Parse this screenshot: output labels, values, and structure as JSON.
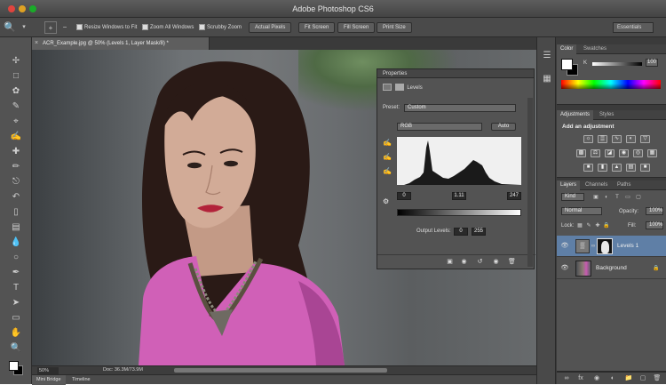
{
  "app": {
    "title": "Adobe Photoshop CS6"
  },
  "options_bar": {
    "checks": [
      "Resize Windows to Fit",
      "Zoom All Windows",
      "Scrubby Zoom"
    ],
    "buttons": [
      "Actual Pixels",
      "Fit Screen",
      "Fill Screen",
      "Print Size"
    ],
    "workspace": "Essentials"
  },
  "document": {
    "tab": "ACR_Example.jpg @ 50% (Levels 1, Layer Mask/8) *",
    "zoom": "50%",
    "info": "Doc: 36.3M/73.9M"
  },
  "mini_bridge": {
    "tabs": [
      "Mini Bridge",
      "Timeline"
    ]
  },
  "properties": {
    "title": "Properties",
    "panel_name": "Levels",
    "preset_label": "Preset:",
    "preset_value": "Custom",
    "channel": "RGB",
    "auto_label": "Auto",
    "input_values": [
      "0",
      "1.11",
      "247"
    ],
    "output_label": "Output Levels:",
    "output_values": [
      "0",
      "255"
    ]
  },
  "color_panel": {
    "tabs": [
      "Color",
      "Swatches"
    ],
    "k_label": "K",
    "k_value": "100"
  },
  "adjustments_panel": {
    "tabs": [
      "Adjustments",
      "Styles"
    ],
    "title": "Add an adjustment"
  },
  "layers_panel": {
    "tabs": [
      "Layers",
      "Channels",
      "Paths"
    ],
    "kind": "Kind",
    "blend_mode": "Normal",
    "opacity_label": "Opacity:",
    "opacity_value": "100%",
    "lock_label": "Lock:",
    "fill_label": "Fill:",
    "fill_value": "100%",
    "layers": [
      {
        "name": "Levels 1",
        "selected": true
      },
      {
        "name": "Background",
        "selected": false
      }
    ]
  },
  "icons": {
    "tools": [
      "move-icon",
      "marquee-icon",
      "lasso-icon",
      "quick-select-icon",
      "crop-icon",
      "eyedropper-icon",
      "healing-icon",
      "brush-icon",
      "stamp-icon",
      "history-brush-icon",
      "eraser-icon",
      "gradient-icon",
      "blur-icon",
      "dodge-icon",
      "pen-icon",
      "type-icon",
      "path-select-icon",
      "shape-icon",
      "hand-icon",
      "zoom-icon"
    ]
  }
}
